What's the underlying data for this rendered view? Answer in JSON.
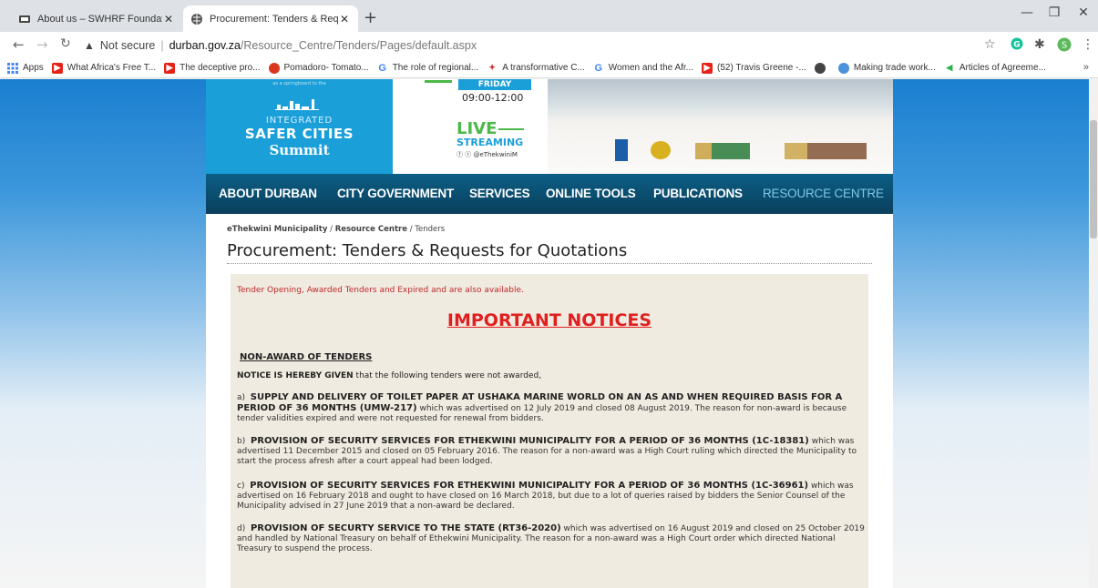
{
  "browser": {
    "tabs": [
      {
        "title": "About us – SWHRF Foundation",
        "active": false
      },
      {
        "title": "Procurement: Tenders & Reques",
        "active": true
      }
    ],
    "address": {
      "security": "Not secure",
      "host": "durban.gov.za",
      "path": "/Resource_Centre/Tenders/Pages/default.aspx"
    },
    "bookmarks": [
      {
        "label": "Apps",
        "icon": "apps-grid-icon"
      },
      {
        "label": "What Africa's Free T...",
        "icon": "youtube-icon"
      },
      {
        "label": "The deceptive pro...",
        "icon": "youtube-icon"
      },
      {
        "label": "Pomadoro- Tomato...",
        "icon": "tomato-icon"
      },
      {
        "label": "The role of regional...",
        "icon": "google-icon"
      },
      {
        "label": "A transformative C...",
        "icon": "people-icon"
      },
      {
        "label": "Women and the Afr...",
        "icon": "google-icon"
      },
      {
        "label": "(52) Travis Greene -...",
        "icon": "youtube-icon"
      },
      {
        "label": "",
        "icon": "globe-icon"
      },
      {
        "label": "Making trade work...",
        "icon": "un-icon"
      },
      {
        "label": "Articles of Agreeme...",
        "icon": "feedly-icon"
      }
    ],
    "profile_initial": "S"
  },
  "banner": {
    "tagline": "as a springboard to the",
    "integrated": "INTEGRATED",
    "safer_cities": "SAFER CITIES",
    "summit": "Summit",
    "day": "FRIDAY",
    "time": "09:00-12:00",
    "live": "LIVE",
    "streaming": "STREAMING",
    "social": "@eThekwiniM"
  },
  "nav": {
    "items": [
      {
        "label": "ABOUT DURBAN"
      },
      {
        "label": "CITY GOVERNMENT"
      },
      {
        "label": "SERVICES"
      },
      {
        "label": "ONLINE TOOLS"
      },
      {
        "label": "PUBLICATIONS"
      },
      {
        "label": "RESOURCE CENTRE",
        "active": true
      }
    ]
  },
  "breadcrumb": {
    "root": "eThekwini Municipality",
    "section": "Resource Centre",
    "current": "Tenders",
    "separator": "/"
  },
  "page": {
    "title": "Procurement: Tenders & Requests for Quotations",
    "intro": "Tender Opening, Awarded Tenders and Expired and are also available.",
    "heading": "IMPORTANT NOTICES",
    "subheading": "NON-AWARD OF TENDERS",
    "lead_bold": "NOTICE IS HEREBY GIVEN",
    "lead_rest": " that the following tenders were not awarded,",
    "items": [
      {
        "marker": "a)",
        "bold": "SUPPLY AND DELIVERY OF TOILET PAPER AT USHAKA MARINE WORLD ON AN AS AND WHEN REQUIRED BASIS FOR A PERIOD OF 36 MONTHS (UMW-217)",
        "text": " which was advertised on 12 July 2019 and closed 08 August 2019. The reason for non-award is because tender validities expired and were not requested for renewal from bidders."
      },
      {
        "marker": "b)",
        "bold": "PROVISION OF SECURITY SERVICES FOR ETHEKWINI MUNICIPALITY FOR A PERIOD OF 36 MONTHS (1C-18381)",
        "text": " which was advertised 11 December 2015 and closed on 05 February 2016. The reason for a non-award was a High Court ruling which directed the Municipality to start the process afresh after a court appeal had been lodged."
      },
      {
        "marker": "c)",
        "bold": "PROVISION OF SECURITY SERVICES FOR ETHEKWINI MUNICIPALITY FOR A PERIOD OF 36 MONTHS (1C-36961)",
        "text": " which was advertised on 16 February 2018 and ought to have closed on 16 March 2018, but due to a lot of queries raised by bidders the Senior Counsel of the Municipality advised in 27 June 2019 that a non-award be declared."
      },
      {
        "marker": "d)",
        "bold": "PROVISION OF SECURTY SERVICE TO THE STATE (RT36-2020)",
        "text": " which was advertised on 16 August 2019 and closed on 25 October 2019 and handled by National Treasury on behalf of Ethekwini Municipality. The reason for a non-award was a High Court order which directed National Treasury to suspend the process."
      }
    ]
  },
  "colors": {
    "nav_bg": "#0b5e85",
    "nav_active": "#7ec8e8",
    "notice_red": "#e02020",
    "intro_red": "#c0282d",
    "content_bg": "#f0ebe0"
  }
}
